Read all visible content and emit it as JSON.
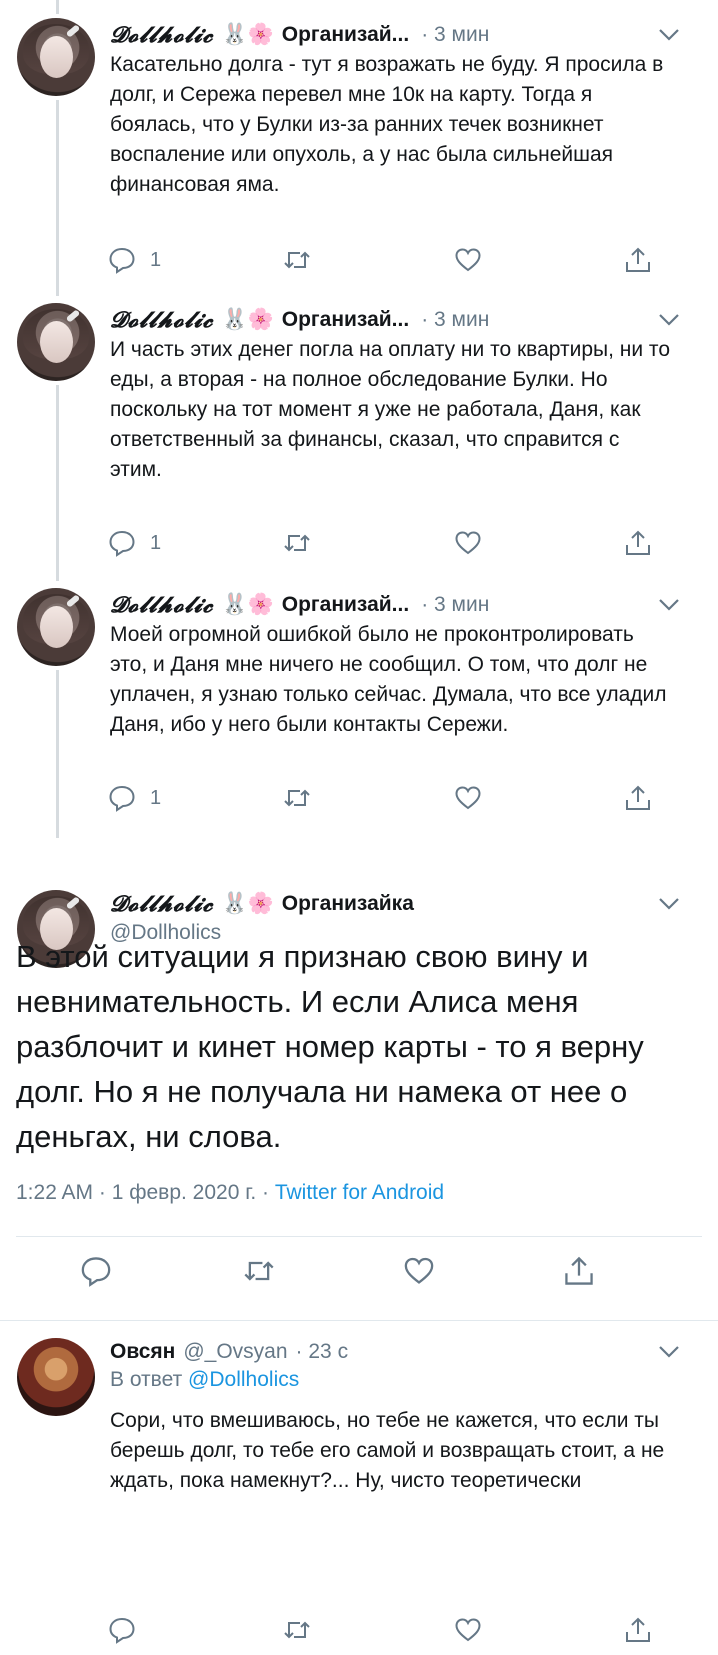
{
  "author": {
    "display_name": "𝓓𝓸𝓵𝓵𝓱𝓸𝓵𝓲𝓬",
    "emoji": "🐰🌸",
    "org_short": "Организай...",
    "org_full": "Организайка",
    "handle": "@Dollholics"
  },
  "thread": [
    {
      "time": "· 3 мин",
      "text": "Касательно долга - тут я возражать не буду. Я просила в долг, и Сережа перевел мне 10к на карту. Тогда я боялась, что у Булки из-за ранних течек возникнет воспаление или опухоль, а у нас была сильнейшая финансовая яма.",
      "replies": "1"
    },
    {
      "time": "· 3 мин",
      "text": "И часть этих денег погла на оплату ни то квартиры, ни то еды, а вторая - на полное обследование Булки. Но поскольку на тот момент я уже не работала, Даня, как ответственный за финансы, сказал, что справится с этим.",
      "replies": "1"
    },
    {
      "time": "· 3 мин",
      "text": "Моей огромной ошибкой было не проконтролировать это, и Даня мне ничего не сообщил. О том, что долг не уплачен, я узнаю только сейчас. Думала, что все уладил Даня, ибо у него были контакты Сережи.",
      "replies": "1"
    }
  ],
  "main_tweet": {
    "text": "В этой ситуации я признаю свою вину и невнимательность. И если Алиса меня разблочит и кинет номер карты - то я верну долг. Но я не получала ни намека от нее о деньгах, ни слова.",
    "timestamp": "1:22 AM · 1 февр. 2020 г. · ",
    "source": "Twitter for Android"
  },
  "reply": {
    "name": "Овсян",
    "handle": "@_Ovsyan",
    "time": "· 23 с",
    "reply_prefix": "В ответ ",
    "reply_handle": "@Dollholics",
    "text": "Сори, что вмешиваюсь, но тебе не кажется, что если ты берешь долг, то тебе его самой и возвращать стоит, а не ждать, пока намекнут?... Ну, чисто теоретически"
  },
  "icons": [
    "reply-icon",
    "retweet-icon",
    "like-icon",
    "share-icon",
    "chevron-down-icon"
  ],
  "colors": {
    "text": "#14171a",
    "secondary": "#657786",
    "link": "#1b95e0",
    "divider": "#e1e8ed"
  }
}
